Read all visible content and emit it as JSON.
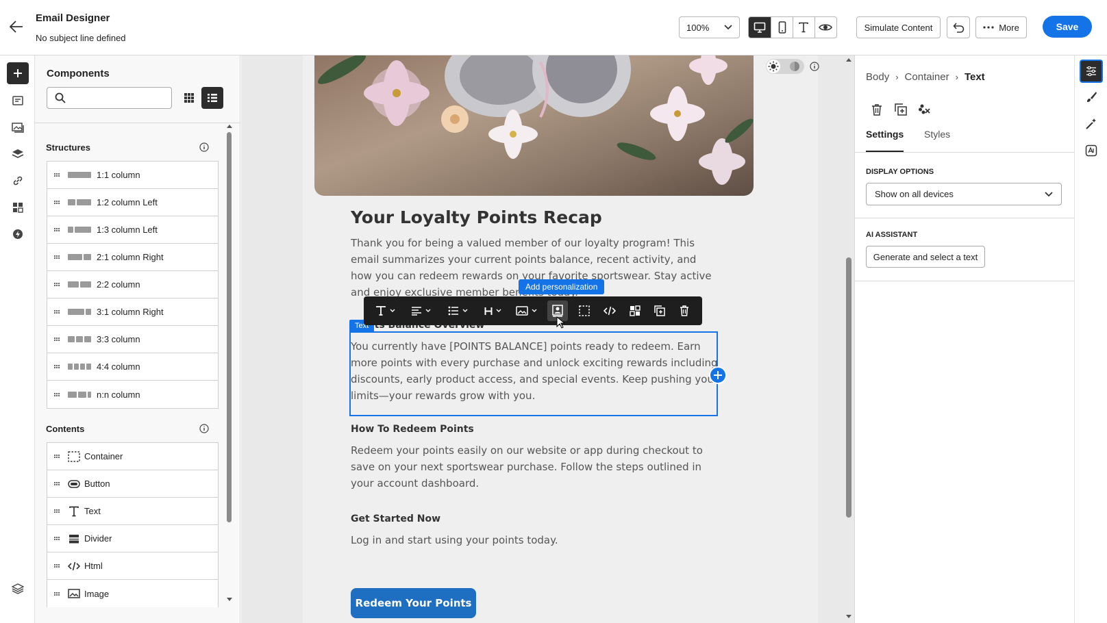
{
  "header": {
    "title": "Email Designer",
    "subtitle": "No subject line defined",
    "zoom": "100%",
    "simulate_label": "Simulate Content",
    "more_label": "More",
    "save_label": "Save"
  },
  "components": {
    "title": "Components",
    "search_placeholder": "",
    "structures_title": "Structures",
    "structures": [
      {
        "label": "1:1 column",
        "cols": [
          1
        ]
      },
      {
        "label": "1:2 column Left",
        "cols": [
          1,
          2
        ]
      },
      {
        "label": "1:3 column Left",
        "cols": [
          1,
          3
        ]
      },
      {
        "label": "2:1 column Right",
        "cols": [
          2,
          1
        ]
      },
      {
        "label": "2:2 column",
        "cols": [
          1,
          1
        ]
      },
      {
        "label": "3:1 column Right",
        "cols": [
          3,
          1
        ]
      },
      {
        "label": "3:3 column",
        "cols": [
          1,
          1,
          1
        ]
      },
      {
        "label": "4:4 column",
        "cols": [
          1,
          1,
          1,
          1
        ]
      },
      {
        "label": "n:n column",
        "cols": [
          1,
          1,
          0.4
        ]
      }
    ],
    "contents_title": "Contents",
    "contents": [
      {
        "label": "Container",
        "icon": "container-icon"
      },
      {
        "label": "Button",
        "icon": "button-icon"
      },
      {
        "label": "Text",
        "icon": "text-icon"
      },
      {
        "label": "Divider",
        "icon": "divider-icon"
      },
      {
        "label": "Html",
        "icon": "html-icon"
      },
      {
        "label": "Image",
        "icon": "image-icon"
      }
    ]
  },
  "email": {
    "heading": "Your Loyalty Points Recap",
    "intro": "Thank you for being a valued member of our loyalty program! This email summarizes your current points balance, recent activity, and how you can redeem rewards on your favorite sportswear. Stay active and enjoy exclusive member benefits today.",
    "section1_title": "Points Balance Overview",
    "section1_text": "You currently have [POINTS BALANCE] points ready to redeem. Earn more points with every purchase and unlock exciting rewards including discounts, early product access, and special events. Keep pushing your limits—your rewards grow with you.",
    "section2_title": "How To Redeem Points",
    "section2_text": "Redeem your points easily on our website or app during checkout to save on your next sportswear purchase. Follow the steps outlined in your account dashboard.",
    "section3_title": "Get Started Now",
    "section3_text": "Log in and start using your points today.",
    "cta_label": "Redeem Your Points",
    "selected_tag": "Text",
    "tooltip": "Add personalization",
    "accent": "#1473e6"
  },
  "settings": {
    "breadcrumb": [
      "Body",
      "Container",
      "Text"
    ],
    "tabs": [
      "Settings",
      "Styles"
    ],
    "active_tab": "Settings",
    "display_options_label": "DISPLAY OPTIONS",
    "display_options_value": "Show on all devices",
    "ai_label": "AI ASSISTANT",
    "ai_button": "Generate and select a text"
  }
}
